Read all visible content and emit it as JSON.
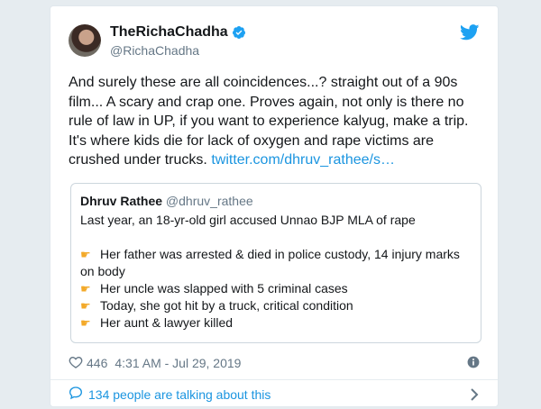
{
  "user": {
    "display_name": "TheRichaChadha",
    "handle": "@RichaChadha"
  },
  "tweet": {
    "text": "And surely these are all coincidences...? straight out of a 90s film... A scary and crap one. Proves again, not only is there no rule of law in UP, if you want to experience kalyug, make a trip. It's where kids die for lack of oxygen and rape victims are crushed under trucks.",
    "link": "twitter.com/dhruv_rathee/s…"
  },
  "quote": {
    "name": "Dhruv Rathee",
    "handle": "@dhruv_rathee",
    "intro": "Last year, an 18-yr-old girl accused Unnao BJP MLA of rape",
    "points": [
      "Her father was arrested & died in police custody, 14 injury marks",
      "on body",
      "Her uncle was slapped with 5 criminal cases",
      "Today, she got hit by a truck, critical condition",
      "Her aunt & lawyer killed"
    ]
  },
  "meta": {
    "likes": "446",
    "timestamp": "4:31 AM - Jul 29, 2019"
  },
  "footer": {
    "talking": "134 people are talking about this"
  },
  "colors": {
    "accent": "#1b95e0",
    "verified": "#1da1f2",
    "secondary_text": "#657786",
    "pointing_hand": "#f3a929"
  },
  "icons": [
    "verified-badge-icon",
    "twitter-bird-icon",
    "heart-icon",
    "info-icon",
    "comment-icon",
    "chevron-right-icon",
    "pointing-hand-icon"
  ]
}
